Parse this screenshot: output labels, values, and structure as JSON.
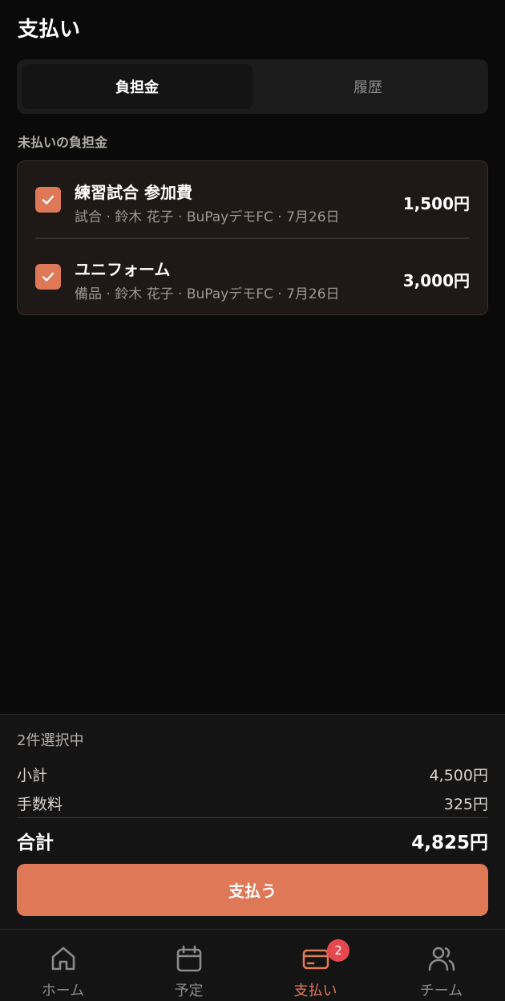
{
  "header": {
    "title": "支払い"
  },
  "tabs": [
    {
      "label": "負担金",
      "active": true
    },
    {
      "label": "履歴",
      "active": false
    }
  ],
  "section_label": "未払いの負担金",
  "items": [
    {
      "name": "練習試合 参加費",
      "sub": "試合 · 鈴木 花子 · BuPayデモFC · 7月26日",
      "price": "1,500円",
      "checked": true
    },
    {
      "name": "ユニフォーム",
      "sub": "備品 · 鈴木 花子 · BuPayデモFC · 7月26日",
      "price": "3,000円",
      "checked": true
    }
  ],
  "summary": {
    "selected_count": "2件選択中",
    "subtotal_label": "小計",
    "subtotal_value": "4,500円",
    "fee_label": "手数料",
    "fee_value": "325円",
    "total_label": "合計",
    "total_value": "4,825円",
    "pay_button": "支払う"
  },
  "nav": [
    {
      "label": "ホーム",
      "icon": "home-icon",
      "active": false
    },
    {
      "label": "予定",
      "icon": "calendar-icon",
      "active": false
    },
    {
      "label": "支払い",
      "icon": "credit-card-icon",
      "active": true,
      "badge": "2"
    },
    {
      "label": "チーム",
      "icon": "team-icon",
      "active": false
    }
  ],
  "colors": {
    "accent": "#df7857",
    "background": "#0a0a0a",
    "badge": "#e5484d"
  }
}
